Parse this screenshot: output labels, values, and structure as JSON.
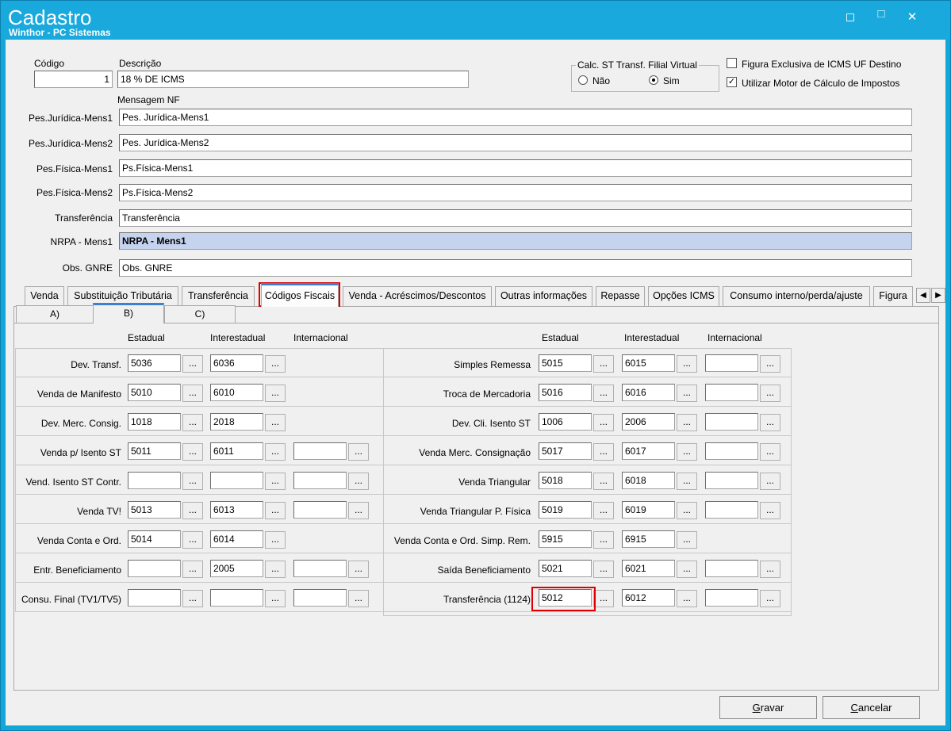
{
  "window": {
    "title": "Cadastro",
    "subtitle": "Winthor - PC Sistemas"
  },
  "header": {
    "codigo_label": "Código",
    "codigo_value": "1",
    "descricao_label": "Descrição",
    "descricao_value": "18 % DE ICMS",
    "calc_st": {
      "legend": "Calc. ST Transf. Filial Virtual",
      "opt_nao": "Não",
      "opt_sim": "Sim",
      "selected": "Sim"
    },
    "chk_figura": {
      "label": "Figura Exclusiva de ICMS UF Destino",
      "checked": false
    },
    "chk_motor": {
      "label": "Utilizar Motor de Cálculo de Impostos",
      "checked": true,
      "mark": "✓"
    },
    "mensagem_label": "Mensagem NF"
  },
  "messages": [
    {
      "label": "Pes.Jurídica-Mens1",
      "value": "Pes. Jurídica-Mens1"
    },
    {
      "label": "Pes.Jurídica-Mens2",
      "value": "Pes. Jurídica-Mens2"
    },
    {
      "label": "Pes.Física-Mens1",
      "value": "Ps.Física-Mens1"
    },
    {
      "label": "Pes.Física-Mens2",
      "value": "Ps.Física-Mens2"
    },
    {
      "label": "Transferência",
      "value": "Transferência"
    },
    {
      "label": "NRPA - Mens1",
      "value": "NRPA - Mens1"
    },
    {
      "label": "Obs. GNRE",
      "value": "Obs. GNRE"
    }
  ],
  "tabs": [
    "Venda",
    "Substituição Tributária",
    "Transferência",
    "Códigos Fiscais",
    "Venda - Acréscimos/Descontos",
    "Outras informações",
    "Repasse",
    "Opções ICMS",
    "Consumo interno/perda/ajuste",
    "Figura"
  ],
  "active_tab": "Códigos Fiscais",
  "subtabs": [
    "A)",
    "B)",
    "C)"
  ],
  "active_subtab": "B)",
  "columns": {
    "estadual": "Estadual",
    "interestadual": "Interestadual",
    "internacional": "Internacional"
  },
  "dots_label": "...",
  "left_rows": [
    {
      "label": "Dev. Transf.",
      "estadual": "5036",
      "interestadual": "6036",
      "internacional": null
    },
    {
      "label": "Venda de Manifesto",
      "estadual": "5010",
      "interestadual": "6010",
      "internacional": null
    },
    {
      "label": "Dev. Merc. Consig.",
      "estadual": "1018",
      "interestadual": "2018",
      "internacional": null
    },
    {
      "label": "Venda p/ Isento ST",
      "estadual": "5011",
      "interestadual": "6011",
      "internacional": ""
    },
    {
      "label": "Vend. Isento ST Contr.",
      "estadual": "",
      "interestadual": "",
      "internacional": ""
    },
    {
      "label": "Venda TV!",
      "estadual": "5013",
      "interestadual": "6013",
      "internacional": ""
    },
    {
      "label": "Venda Conta e Ord.",
      "estadual": "5014",
      "interestadual": "6014",
      "internacional": null
    },
    {
      "label": "Entr. Beneficiamento",
      "estadual": "",
      "interestadual": "2005",
      "internacional": ""
    },
    {
      "label": "Consu. Final (TV1/TV5)",
      "estadual": "",
      "interestadual": "",
      "internacional": ""
    }
  ],
  "right_rows": [
    {
      "label": "Simples Remessa",
      "estadual": "5015",
      "interestadual": "6015",
      "internacional": ""
    },
    {
      "label": "Troca de Mercadoria",
      "estadual": "5016",
      "interestadual": "6016",
      "internacional": ""
    },
    {
      "label": "Dev. Cli. Isento ST",
      "estadual": "1006",
      "interestadual": "2006",
      "internacional": ""
    },
    {
      "label": "Venda Merc. Consignação",
      "estadual": "5017",
      "interestadual": "6017",
      "internacional": ""
    },
    {
      "label": "Venda Triangular",
      "estadual": "5018",
      "interestadual": "6018",
      "internacional": ""
    },
    {
      "label": "Venda Triangular P. Física",
      "estadual": "5019",
      "interestadual": "6019",
      "internacional": ""
    },
    {
      "label": "Venda Conta e Ord. Simp. Rem.",
      "estadual": "5915",
      "interestadual": "6915",
      "internacional": null
    },
    {
      "label": "Saída Beneficiamento",
      "estadual": "5021",
      "interestadual": "6021",
      "internacional": ""
    },
    {
      "label": "Transferência (1124)",
      "estadual": "5012",
      "interestadual": "6012",
      "internacional": ""
    }
  ],
  "buttons": {
    "gravar": "Gravar",
    "cancelar": "Cancelar"
  },
  "colors": {
    "titlebar": "#1aa9dd",
    "highlight": "#e00000",
    "selected_field": "#c5d3ee",
    "tab_accent": "#3d7fd0"
  }
}
